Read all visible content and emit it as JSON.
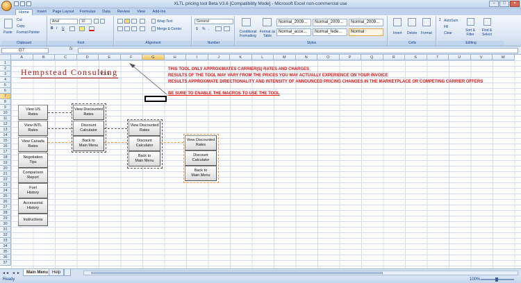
{
  "window": {
    "title": "XLTL pricing tool Beta V3.6 [Compatibility Mode] - Microsoft Excel non-commercial use"
  },
  "ribbon": {
    "tabs": [
      "Home",
      "Insert",
      "Page Layout",
      "Formulas",
      "Data",
      "Review",
      "View",
      "Add-Ins"
    ],
    "active_tab": "Home",
    "clipboard": {
      "paste": "Paste",
      "cut": "Cut",
      "copy": "Copy",
      "format_painter": "Format Painter",
      "label": "Clipboard"
    },
    "font": {
      "name": "Arial",
      "size": "10",
      "label": "Font"
    },
    "alignment": {
      "wrap_text": "Wrap Text",
      "merge_center": "Merge & Center",
      "label": "Alignment"
    },
    "number": {
      "format": "General",
      "label": "Number"
    },
    "styles": {
      "conditional": "Conditional Formatting",
      "format_table": "Format as Table",
      "cells": [
        "Normal_2009...",
        "Normal_2009...",
        "Normal_2009...",
        "Normal_acce...",
        "Normal_fede...",
        "Normal"
      ],
      "label": "Styles"
    },
    "cells": {
      "insert": "Insert",
      "delete": "Delete",
      "format": "Format",
      "label": "Cells"
    },
    "editing": {
      "autosum": "AutoSum",
      "fill": "Fill",
      "clear": "Clear",
      "sort_filter": "Sort & Filter",
      "find_select": "Find & Select",
      "label": "Editing"
    }
  },
  "formula_bar": {
    "name_box": "G7",
    "fx": "fx",
    "value": ""
  },
  "grid": {
    "columns": [
      "A",
      "B",
      "C",
      "D",
      "E",
      "F",
      "G",
      "H",
      "I",
      "J",
      "K",
      "L",
      "M",
      "N",
      "O",
      "P",
      "Q",
      "R",
      "S",
      "T",
      "U",
      "V",
      "W"
    ],
    "rows": [
      "1",
      "2",
      "3",
      "4",
      "5",
      "6",
      "7",
      "8",
      "9",
      "10",
      "11",
      "12",
      "13",
      "14",
      "15",
      "16",
      "17",
      "18",
      "19",
      "20",
      "21",
      "22",
      "23",
      "24",
      "25",
      "26",
      "27",
      "28",
      "29",
      "30",
      "31",
      "32",
      "33",
      "34",
      "35",
      "36",
      "37"
    ],
    "selected_column": "G",
    "selected_row": "7"
  },
  "sheet": {
    "logo": "Hempstead Consulting",
    "version": "V3.5",
    "notices": [
      "THIS TOOL ONLY APPROXIMATES CARRIER(S) RATES AND CHARGES",
      "RESULTS OF THE TOOL MAY VARY FROM THE PRICES YOU MAY ACTUALLY EXPERIENCE ON YOUR INVOICE",
      "RESULTS APPROXIMATE DIRECTIONALITY AND INTENSITY OF ANNOUNCED PRICING CHANGES IN THE MARKETPLACE OR COMPETING CARRIER OFFERS",
      "BE SURE TO ENABLE THE MACROS TO USE THE TOOL"
    ],
    "main_menu": [
      "View US\nRates",
      "View INTL\nRates",
      "View Canada\nRates",
      "Negotiation\nTips",
      "Comparison\nReport",
      "Fuel\nHistory",
      "Accessorial\nHistory",
      "Instructions"
    ],
    "submenu_us": [
      "View Discounted\nRates",
      "Discount\nCalculator",
      "Back to\nMain Menu"
    ],
    "submenu_intl": [
      "View Discounted\nRates",
      "Discount\nCalculator",
      "Back to\nMain Menu"
    ],
    "submenu_canada": [
      "View Discounted\nRates",
      "Discount\nCalculator",
      "Back to\nMain Menu"
    ]
  },
  "sheet_tabs": [
    "Main Menu",
    "Help"
  ],
  "active_sheet": "Main Menu",
  "status": {
    "text": "Ready",
    "zoom": "100%"
  },
  "colors": {
    "notice_red": "#e01010",
    "logo_red": "#b01515",
    "orange_connector": "#f09a4a"
  }
}
